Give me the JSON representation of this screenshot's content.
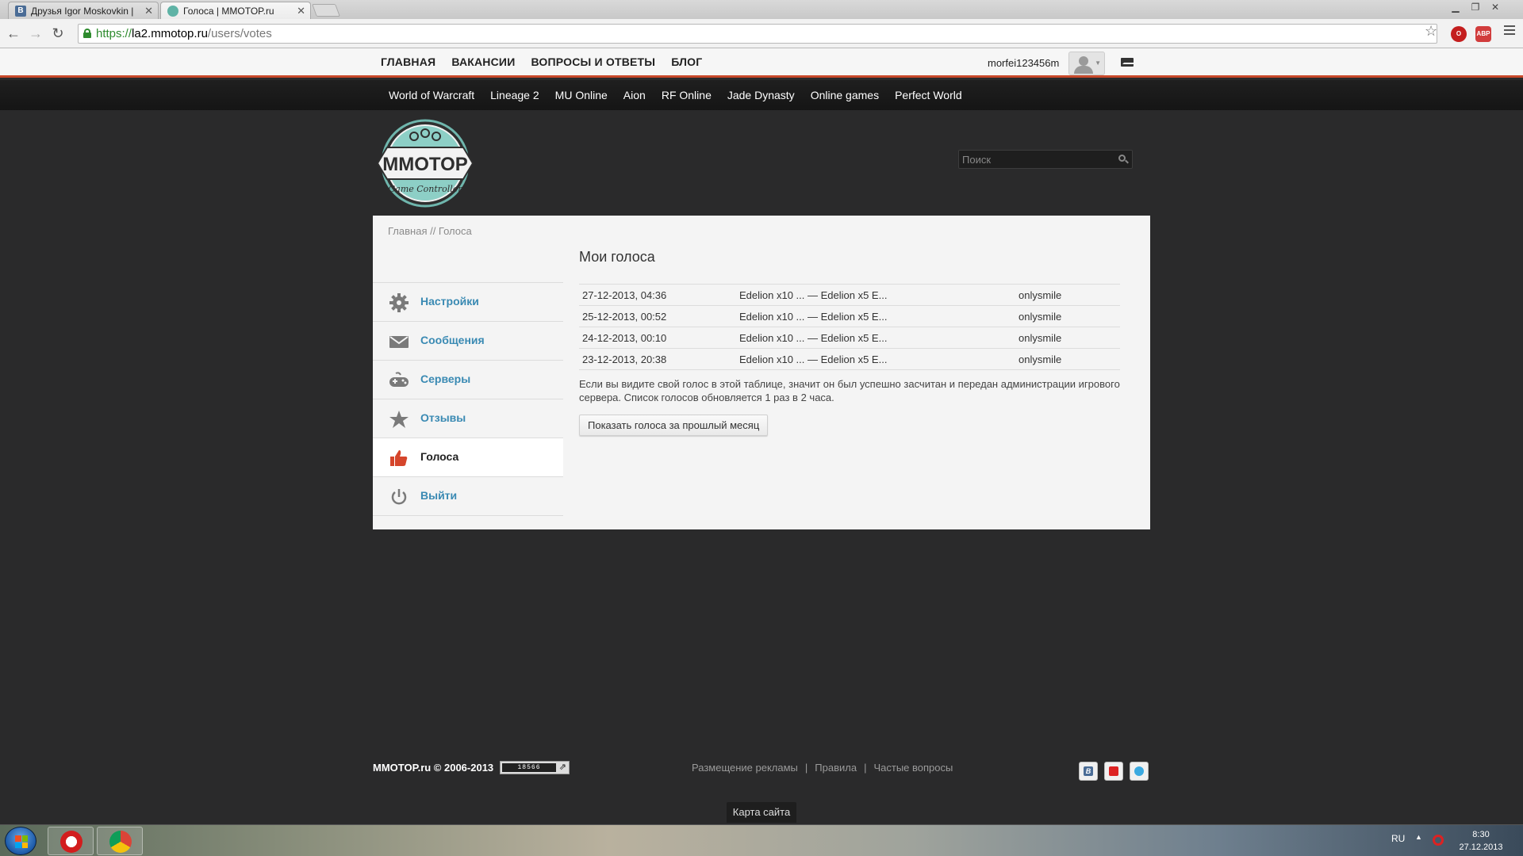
{
  "browser": {
    "tabs": [
      {
        "label": "Друзья Igor Moskovkin | ",
        "favicon": "В"
      },
      {
        "label": "Голоса | MMOTOP.ru"
      }
    ],
    "url": {
      "scheme": "https://",
      "host": "la2.mmotop.ru",
      "path": "/users/votes"
    },
    "extensions": [
      "opera-icon",
      "adblock-icon"
    ],
    "adblock_label": "ABP"
  },
  "topbar": {
    "nav": [
      "ГЛАВНАЯ",
      "ВАКАНСИИ",
      "ВОПРОСЫ И ОТВЕТЫ",
      "БЛОГ"
    ],
    "username": "morfei123456m"
  },
  "games": [
    "World of Warcraft",
    "Lineage 2",
    "MU Online",
    "Aion",
    "RF Online",
    "Jade Dynasty",
    "Online games",
    "Perfect World"
  ],
  "logo": {
    "main": "MMOTOP",
    "sub": "Game Controller"
  },
  "search": {
    "placeholder": "Поиск"
  },
  "breadcrumb": "Главная // Голоса",
  "sidebar": {
    "items": [
      {
        "label": "Настройки",
        "icon": "gear-icon"
      },
      {
        "label": "Сообщения",
        "icon": "envelope-icon"
      },
      {
        "label": "Серверы",
        "icon": "gamepad-icon"
      },
      {
        "label": "Отзывы",
        "icon": "star-icon"
      },
      {
        "label": "Голоса",
        "icon": "thumbs-up-icon",
        "active": true
      },
      {
        "label": "Выйти",
        "icon": "power-icon"
      }
    ]
  },
  "main": {
    "heading": "Мои голоса",
    "votes": [
      {
        "date": "27-12-2013, 04:36",
        "server": "Edelion x10 ... — Edelion x5 E...",
        "user": "onlysmile"
      },
      {
        "date": "25-12-2013, 00:52",
        "server": "Edelion x10 ... — Edelion x5 E...",
        "user": "onlysmile"
      },
      {
        "date": "24-12-2013, 00:10",
        "server": "Edelion x10 ... — Edelion x5 E...",
        "user": "onlysmile"
      },
      {
        "date": "23-12-2013, 20:38",
        "server": "Edelion x10 ... — Edelion x5 E...",
        "user": "onlysmile"
      }
    ],
    "note": "Если вы видите свой голос в этой таблице, значит он был успешно засчитан и передан администрации игрового сервера. Список голосов обновляется 1 раз в 2 часа.",
    "prev_month_button": "Показать голоса за прошлый месяц"
  },
  "footer": {
    "copyright": "MMOTOP.ru © 2006-2013",
    "counter": "18566",
    "links": [
      "Размещение рекламы",
      "Правила",
      "Частые вопросы"
    ],
    "social": [
      "vk-icon",
      "youtube-icon",
      "twitter-icon"
    ],
    "vk_label": "В",
    "sitemap": "Карта сайта"
  },
  "taskbar": {
    "lang": "RU",
    "time": "8:30",
    "date": "27.12.2013"
  },
  "colors": {
    "accent": "#c8482a",
    "link": "#3a8ab3",
    "panel": "#f4f4f4",
    "background": "#2a2a2b"
  }
}
